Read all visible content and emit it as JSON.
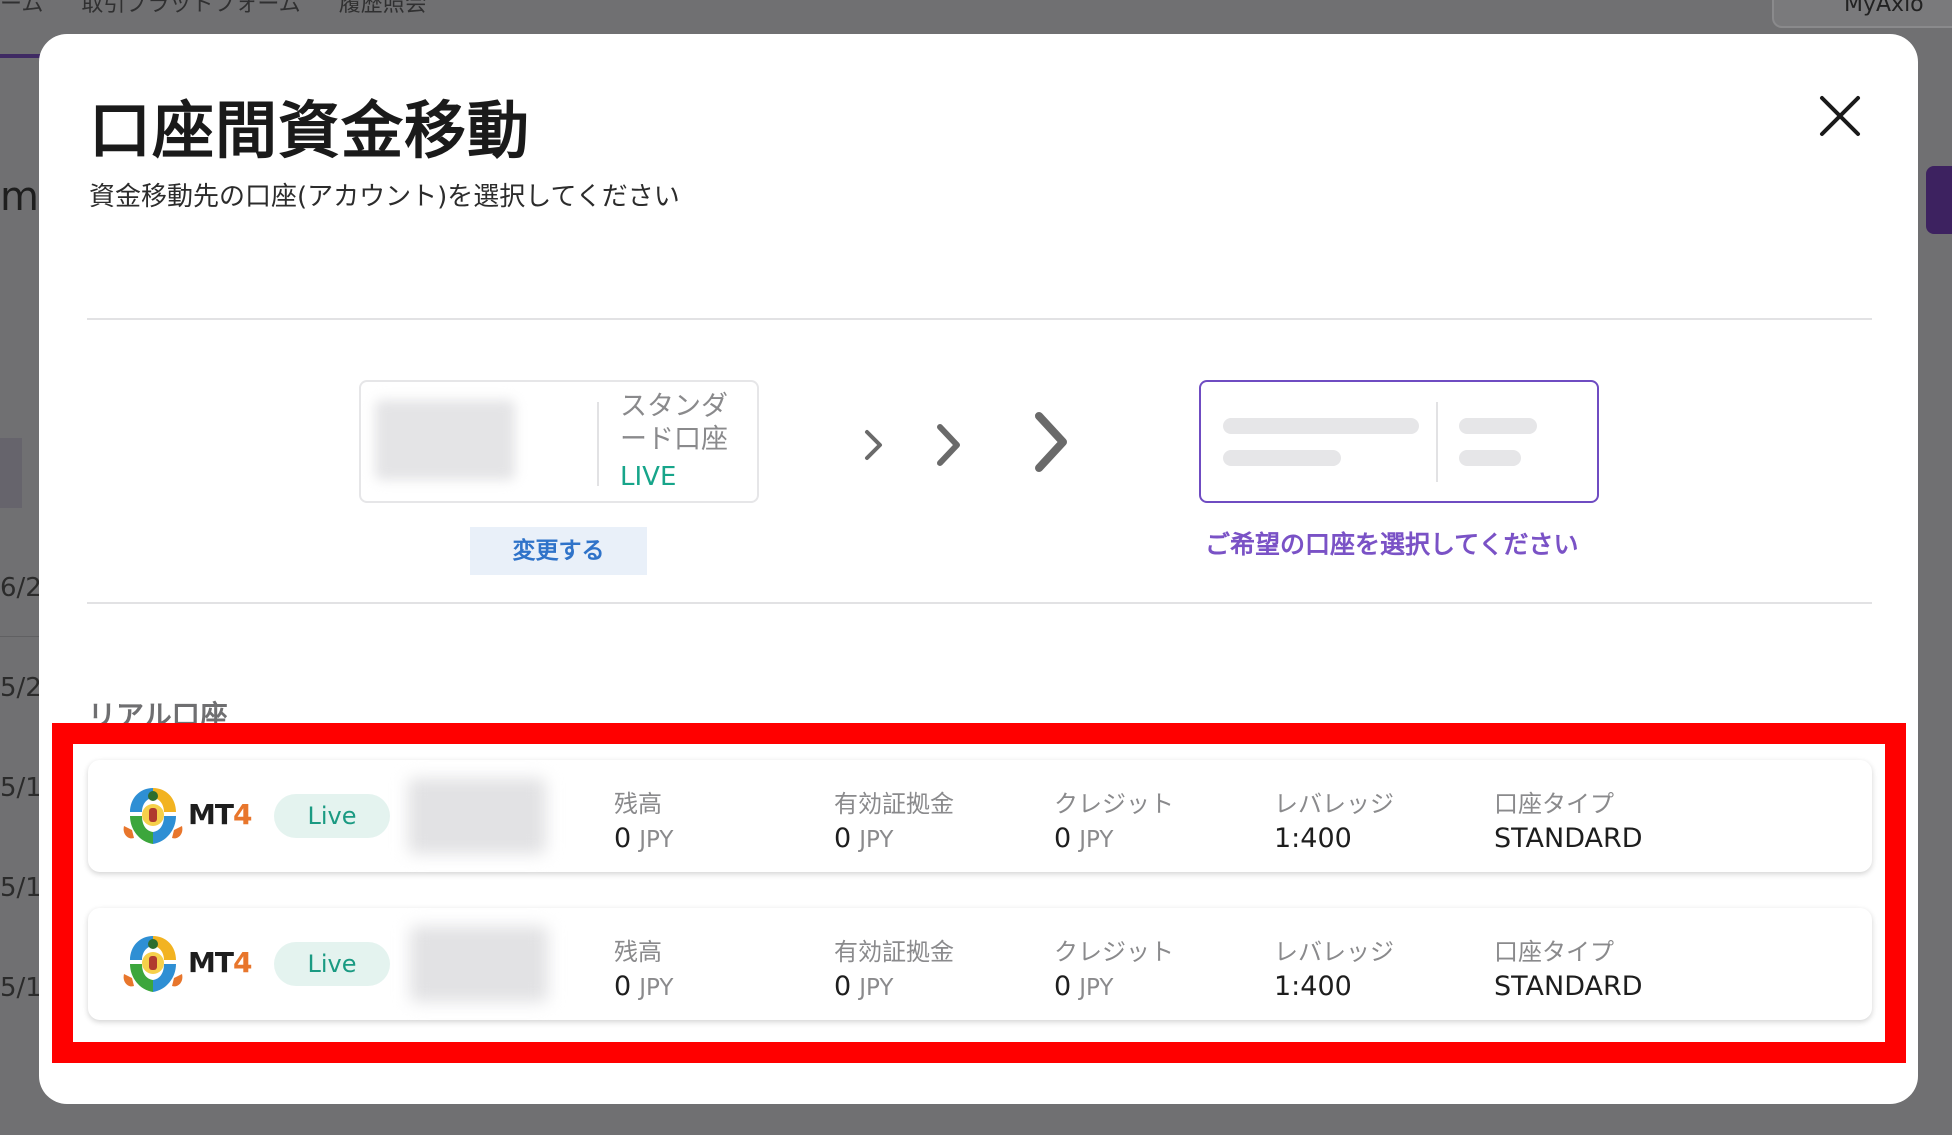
{
  "background": {
    "tabs": [
      "ーム",
      "取引プラットフォーム",
      "履歴照会"
    ],
    "account_button": "MyAxio",
    "left_char": "m",
    "left_dates": [
      "6/2",
      "5/2",
      "5/1",
      "5/1",
      "5/1"
    ]
  },
  "modal": {
    "title": "口座間資金移動",
    "subtitle": "資金移動先の口座(アカウント)を選択してください",
    "close_icon": "close-icon"
  },
  "source_account": {
    "type_label": "スタンダード口座",
    "status": "LIVE",
    "change_button": "変更する"
  },
  "destination": {
    "prompt": "ご希望の口座を選択してください"
  },
  "section": {
    "label": "リアル口座"
  },
  "accounts": [
    {
      "platform_main": "MT",
      "platform_num": "4",
      "status": "Live",
      "balance_label": "残高",
      "balance_value": "0",
      "balance_unit": "JPY",
      "equity_label": "有効証拠金",
      "equity_value": "0",
      "equity_unit": "JPY",
      "credit_label": "クレジット",
      "credit_value": "0",
      "credit_unit": "JPY",
      "leverage_label": "レバレッジ",
      "leverage_value": "1:400",
      "type_label": "口座タイプ",
      "type_value": "STANDARD"
    },
    {
      "platform_main": "MT",
      "platform_num": "4",
      "status": "Live",
      "balance_label": "残高",
      "balance_value": "0",
      "balance_unit": "JPY",
      "equity_label": "有効証拠金",
      "equity_value": "0",
      "equity_unit": "JPY",
      "credit_label": "クレジット",
      "credit_value": "0",
      "credit_unit": "JPY",
      "leverage_label": "レバレッジ",
      "leverage_value": "1:400",
      "type_label": "口座タイプ",
      "type_value": "STANDARD"
    }
  ],
  "colors": {
    "accent_purple": "#6f4cc2",
    "live_green": "#17a58a",
    "link_blue": "#2f73c9",
    "highlight_red": "#ff0000"
  }
}
